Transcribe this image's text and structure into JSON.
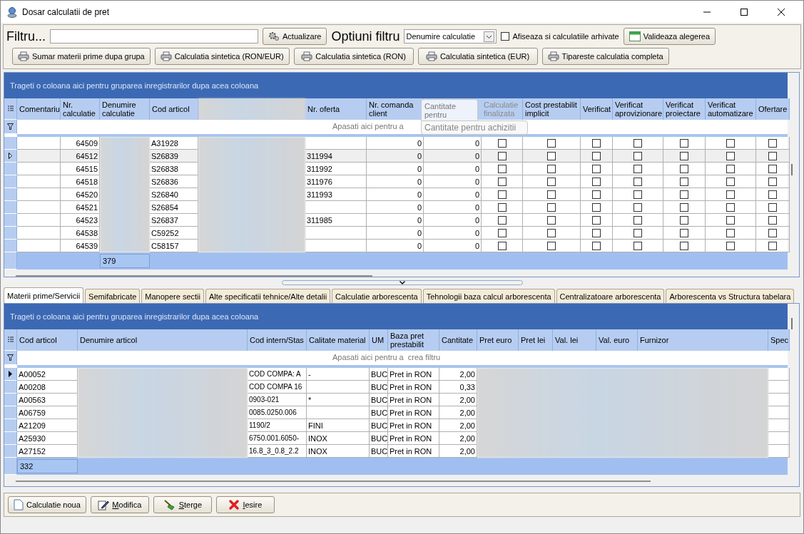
{
  "window": {
    "title": "Dosar calculatii de pret"
  },
  "filter": {
    "label": "Filtru...",
    "refresh_button": "Actualizare",
    "options_label": "Optiuni filtru",
    "options_value": "Denumire calculatie",
    "show_archived": {
      "label": "Afiseaza si calculatiile arhivate",
      "checked": false
    },
    "validate_button": "Valideaza alegerea"
  },
  "print_buttons": [
    "Sumar materii prime dupa grupa",
    "Calculatia sintetica (RON/EUR)",
    "Calculatia sintetica (RON)",
    "Calculatia sintetica (EUR)",
    "Tipareste calculatia completa"
  ],
  "calculations_grid": {
    "group_hint": "Trageti o coloana aici pentru gruparea inregistrarilor dupa acea coloana",
    "columns": [
      "Comentariu",
      "Nr. calculatie",
      "Denumire calculatie",
      "Cod articol",
      "Nr. oferta",
      "Nr. comanda client",
      "Calculatie finalizata",
      "Cost prestabilit implicit",
      "Verificat",
      "Verificat aprovizionare",
      "Verificat proiectare",
      "Verificat automatizare",
      "Ofertare"
    ],
    "filter_hint": "Apasati aici pentru a",
    "drag_header": "Cantitate pentru",
    "drag_hint": "Cantitate pentru achizitii",
    "rows": [
      {
        "nr": "64509",
        "cod": "A31928",
        "comanda": "0",
        "cantitate": "0",
        "checks": [
          false,
          false,
          false,
          false,
          false,
          false,
          false
        ],
        "selected": false
      },
      {
        "nr": "64512",
        "cod": "S26839",
        "oferta": "311994",
        "comanda": "0",
        "cantitate": "0",
        "checks": [
          false,
          false,
          false,
          false,
          false,
          false,
          false
        ],
        "selected": true
      },
      {
        "nr": "64515",
        "cod": "S26838",
        "oferta": "311992",
        "comanda": "0",
        "cantitate": "0",
        "checks": [
          false,
          false,
          false,
          false,
          false,
          false,
          false
        ],
        "selected": false
      },
      {
        "nr": "64518",
        "cod": "S26836",
        "oferta": "311976",
        "comanda": "0",
        "cantitate": "0",
        "checks": [
          false,
          false,
          false,
          false,
          false,
          false,
          false
        ],
        "selected": false
      },
      {
        "nr": "64520",
        "cod": "S26840",
        "oferta": "311993",
        "comanda": "0",
        "cantitate": "0",
        "checks": [
          false,
          false,
          false,
          false,
          false,
          false,
          false
        ],
        "selected": false
      },
      {
        "nr": "64521",
        "cod": "S26854",
        "comanda": "0",
        "cantitate": "0",
        "checks": [
          false,
          false,
          false,
          false,
          false,
          false,
          false
        ],
        "selected": false
      },
      {
        "nr": "64523",
        "cod": "S26837",
        "oferta": "311985",
        "comanda": "0",
        "cantitate": "0",
        "checks": [
          false,
          false,
          false,
          false,
          false,
          false,
          false
        ],
        "selected": false
      },
      {
        "nr": "64538",
        "cod": "C59252",
        "comanda": "0",
        "cantitate": "0",
        "checks": [
          false,
          false,
          false,
          false,
          false,
          false,
          false
        ],
        "selected": false
      },
      {
        "nr": "64539",
        "cod": "C58157",
        "comanda": "0",
        "cantitate": "0",
        "checks": [
          false,
          false,
          false,
          false,
          false,
          false,
          false
        ],
        "selected": false
      }
    ],
    "count": "379"
  },
  "tabs": [
    {
      "label": "Materii prime/Servicii",
      "selected": true
    },
    {
      "label": "Semifabricate",
      "selected": false
    },
    {
      "label": "Manopere sectii",
      "selected": false
    },
    {
      "label": "Alte specificatii tehnice/Alte detalii",
      "selected": false
    },
    {
      "label": "Calculatie arborescenta",
      "selected": false
    },
    {
      "label": "Tehnologii baza calcul arborescenta",
      "selected": false
    },
    {
      "label": "Centralizatoare arborescenta",
      "selected": false
    },
    {
      "label": "Arborescenta vs Structura tabelara",
      "selected": false
    }
  ],
  "materials_grid": {
    "group_hint": "Trageti o coloana aici pentru gruparea inregistrarilor dupa acea coloana",
    "columns": [
      "Cod articol",
      "Denumire articol",
      "Cod intern/Stas",
      "Calitate material",
      "UM",
      "Baza pret prestabilit",
      "Cantitate",
      "Pret euro",
      "Pret lei",
      "Val. lei",
      "Val. euro",
      "Furnizor",
      "Spec"
    ],
    "filter_hint": "Apasati aici pentru a  crea filtru",
    "rows": [
      {
        "cod": "A00052",
        "cod_intern": "COD COMPA: A",
        "calitate": "-",
        "um": "BUC",
        "baza": "Pret in RON",
        "cantitate": "2,00",
        "selected": true
      },
      {
        "cod": "A00208",
        "cod_intern": "COD COMPA 16",
        "um": "BUC",
        "baza": "Pret in RON",
        "cantitate": "0,33",
        "selected": false
      },
      {
        "cod": "A00563",
        "cod_intern": "0903-021",
        "calitate": "*",
        "um": "BUC",
        "baza": "Pret in RON",
        "cantitate": "2,00",
        "selected": false
      },
      {
        "cod": "A06759",
        "cod_intern": "0085.0250.006",
        "um": "BUC",
        "baza": "Pret in RON",
        "cantitate": "2,00",
        "selected": false
      },
      {
        "cod": "A21209",
        "cod_intern": "1190/2",
        "calitate": "FINI",
        "um": "BUC",
        "baza": "Pret in RON",
        "cantitate": "2,00",
        "selected": false
      },
      {
        "cod": "A25930",
        "cod_intern": "6750.001.6050-",
        "calitate": "INOX",
        "um": "BUC",
        "baza": "Pret in RON",
        "cantitate": "2,00",
        "selected": false
      },
      {
        "cod": "A27152",
        "cod_intern": "16.8_3_0.8_2.2",
        "calitate": "INOX",
        "um": "BUC",
        "baza": "Pret in RON",
        "cantitate": "2,00",
        "selected": false
      }
    ],
    "count": "332"
  },
  "actions": [
    {
      "label": "Calculatie noua",
      "kind": "new",
      "accelerator": false
    },
    {
      "label": "Modifica",
      "kind": "edit",
      "accelerator": true
    },
    {
      "label": "Sterge",
      "kind": "delete",
      "accelerator": true
    },
    {
      "label": "Iesire",
      "kind": "exit",
      "accelerator": true
    }
  ]
}
